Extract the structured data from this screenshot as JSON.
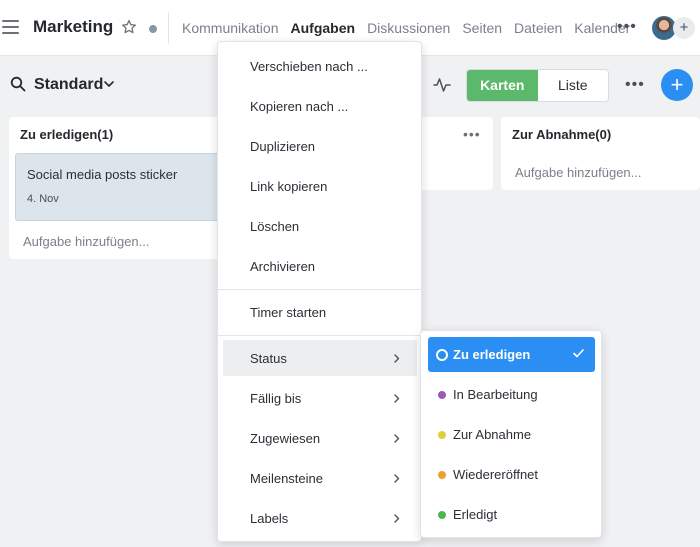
{
  "header": {
    "workspace_title": "Marketing",
    "tabs": [
      {
        "label": "Kommunikation",
        "active": false
      },
      {
        "label": "Aufgaben",
        "active": true
      },
      {
        "label": "Diskussionen",
        "active": false
      },
      {
        "label": "Seiten",
        "active": false
      },
      {
        "label": "Dateien",
        "active": false
      },
      {
        "label": "Kalender",
        "active": false
      }
    ],
    "more_label": "•••",
    "add_member_label": "+"
  },
  "toolbar": {
    "view_name": "Standard",
    "view_toggle": [
      {
        "label": "Karten",
        "active": true
      },
      {
        "label": "Liste",
        "active": false
      }
    ],
    "more_label": "•••",
    "add_label": "+"
  },
  "board": {
    "columns": [
      {
        "title": "Zu erledigen(1)",
        "cards": [
          {
            "title": "Social media posts sticker",
            "date": "4. Nov"
          }
        ],
        "add_task_label": "Aufgabe hinzufügen..."
      },
      {
        "more_label": "•••"
      },
      {
        "title": "Zur Abnahme(0)",
        "add_task_label": "Aufgabe hinzufügen..."
      }
    ]
  },
  "context_menu": {
    "items": [
      {
        "label": "Verschieben nach ..."
      },
      {
        "label": "Kopieren nach ..."
      },
      {
        "label": "Duplizieren"
      },
      {
        "label": "Link kopieren"
      },
      {
        "label": "Löschen"
      },
      {
        "label": "Archivieren"
      },
      {
        "label": "Timer starten"
      },
      {
        "label": "Status",
        "has_submenu": true,
        "highlighted": true
      },
      {
        "label": "Fällig bis",
        "has_submenu": true
      },
      {
        "label": "Zugewiesen",
        "has_submenu": true
      },
      {
        "label": "Meilensteine",
        "has_submenu": true
      },
      {
        "label": "Labels",
        "has_submenu": true
      }
    ]
  },
  "status_submenu": {
    "items": [
      {
        "label": "Zu erledigen",
        "color": "#ffffff",
        "selected": true
      },
      {
        "label": "In Bearbeitung",
        "color": "#9b59b6",
        "selected": false
      },
      {
        "label": "Zur Abnahme",
        "color": "#e0cd3a",
        "selected": false
      },
      {
        "label": "Wiedereröffnet",
        "color": "#f0a030",
        "selected": false
      },
      {
        "label": "Erledigt",
        "color": "#4cb84c",
        "selected": false
      }
    ]
  },
  "colors": {
    "accent_blue": "#2b8ef2",
    "accent_green": "#5cb86a",
    "card_bg": "#dde5ec"
  }
}
